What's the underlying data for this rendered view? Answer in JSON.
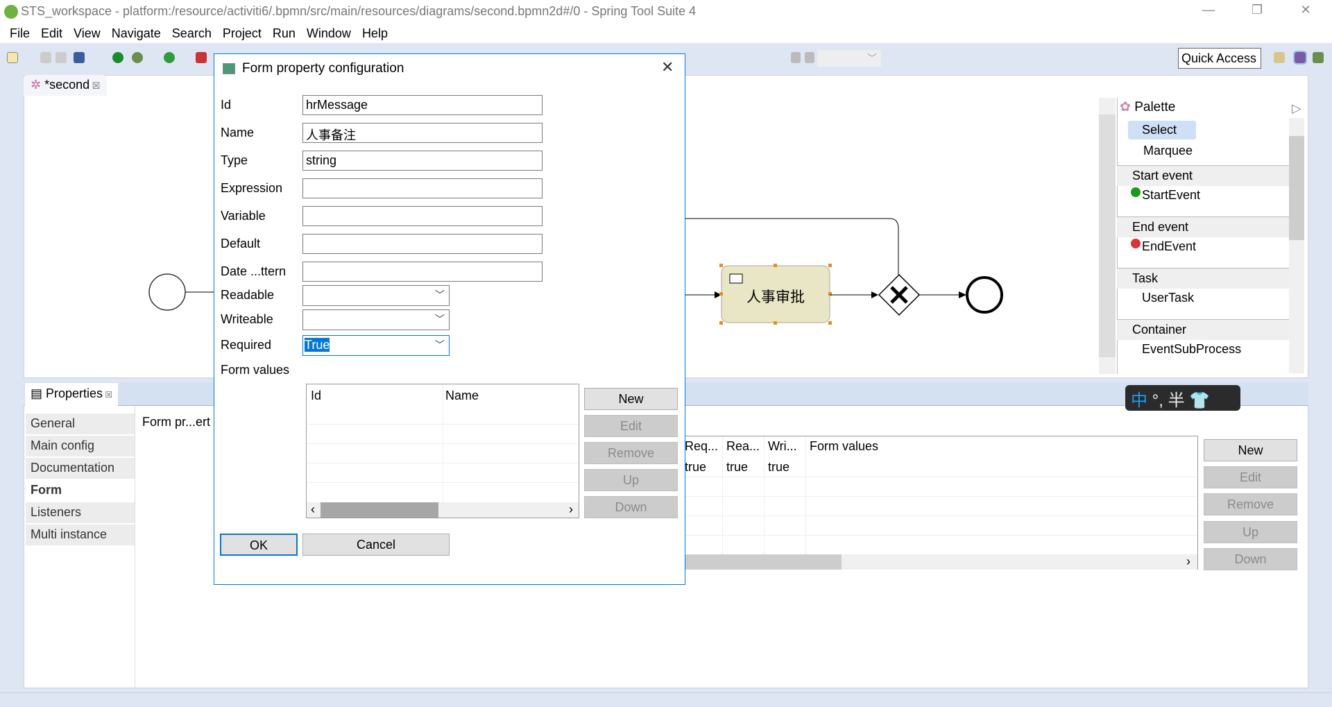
{
  "window": {
    "title": "STS_workspace - platform:/resource/activiti6/.bpmn/src/main/resources/diagrams/second.bpmn2d#/0 - Spring Tool Suite 4"
  },
  "menu": [
    "File",
    "Edit",
    "View",
    "Navigate",
    "Search",
    "Project",
    "Run",
    "Window",
    "Help"
  ],
  "toolbar": {
    "quick_access": "Quick Access"
  },
  "editor": {
    "tab": "*second",
    "task_label": "人事审批"
  },
  "palette": {
    "title": "Palette",
    "tools": [
      "Select",
      "Marquee"
    ],
    "sections": [
      {
        "label": "Start event",
        "item": "StartEvent"
      },
      {
        "label": "End event",
        "item": "EndEvent"
      },
      {
        "label": "Task",
        "item": "UserTask"
      },
      {
        "label": "Container",
        "item": "EventSubProcess"
      }
    ]
  },
  "properties": {
    "tab": "Properties",
    "nav": [
      "General",
      "Main config",
      "Documentation",
      "Form",
      "Listeners",
      "Multi instance"
    ],
    "active_nav": "Form",
    "section_label": "Form pr...ert",
    "columns": [
      "Req...",
      "Rea...",
      "Wri...",
      "Form values"
    ],
    "row": [
      "true",
      "true",
      "true",
      ""
    ],
    "buttons": [
      "New",
      "Edit",
      "Remove",
      "Up",
      "Down"
    ]
  },
  "ime": {
    "mode": "中",
    "punct": "°,",
    "width": "半"
  },
  "dialog": {
    "title": "Form property configuration",
    "fields": [
      {
        "label": "Id",
        "value": "hrMessage"
      },
      {
        "label": "Name",
        "value": "人事备注"
      },
      {
        "label": "Type",
        "value": "string"
      },
      {
        "label": "Expression",
        "value": ""
      },
      {
        "label": "Variable",
        "value": ""
      },
      {
        "label": "Default",
        "value": ""
      },
      {
        "label": "Date ...ttern",
        "value": ""
      }
    ],
    "combos": [
      {
        "label": "Readable",
        "value": ""
      },
      {
        "label": "Writeable",
        "value": ""
      },
      {
        "label": "Required",
        "value": "True"
      }
    ],
    "form_values_label": "Form values",
    "table_columns": [
      "Id",
      "Name"
    ],
    "buttons": [
      "New",
      "Edit",
      "Remove",
      "Up",
      "Down"
    ],
    "ok": "OK",
    "cancel": "Cancel"
  }
}
